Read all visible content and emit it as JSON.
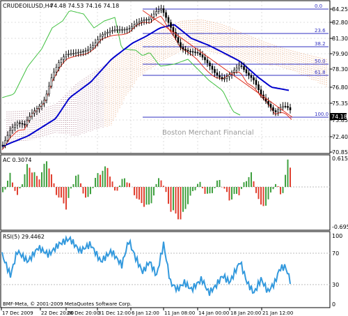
{
  "main": {
    "symbol": "CRUDEOILUSD,H4",
    "ohlc": "74.48 74.53 74.16 74.18",
    "price_labels": [
      "84.25",
      "82.80",
      "81.30",
      "79.90",
      "78.30",
      "76.80",
      "75.35",
      "73.85",
      "72.40",
      "70.85"
    ],
    "fib_levels": [
      "0.0",
      "23.6",
      "38.2",
      "50.0",
      "61.8",
      "100.0"
    ],
    "current_price": "74.18",
    "watermark": "Boston Merchant Financial"
  },
  "ac": {
    "label": "AC 0.3074",
    "ticks": [
      "0.6154",
      "-0.695"
    ]
  },
  "rsi": {
    "label": "RSI(5) 29.4462",
    "ticks": [
      "100",
      "70",
      "30",
      "0"
    ]
  },
  "footer": {
    "copyright": "BMF-Meta, © 2001-2009 MetaQuotes Software Corp."
  },
  "time_labels": [
    "17 Dec 2009",
    "22 Dec 20:00",
    "28 Dec 20:00",
    "31 Dec 12:00",
    "6 Jan 12:00",
    "11 Jan 08:00",
    "14 Jan 00:00",
    "18 Jan 20:00",
    "21 Jan 12:00"
  ],
  "colors": {
    "candle": "#000000",
    "ma_blue": "#0000cc",
    "ma_red": "#e03020",
    "chikou_green": "#40c040",
    "cloud_orange": "#e8a070",
    "cloud_purple": "#b08090",
    "fib_line": "#3030c0",
    "ac_up": "#40a040",
    "ac_down": "#e04030",
    "rsi_line": "#3399dd",
    "grid": "#bbbbbb"
  }
}
